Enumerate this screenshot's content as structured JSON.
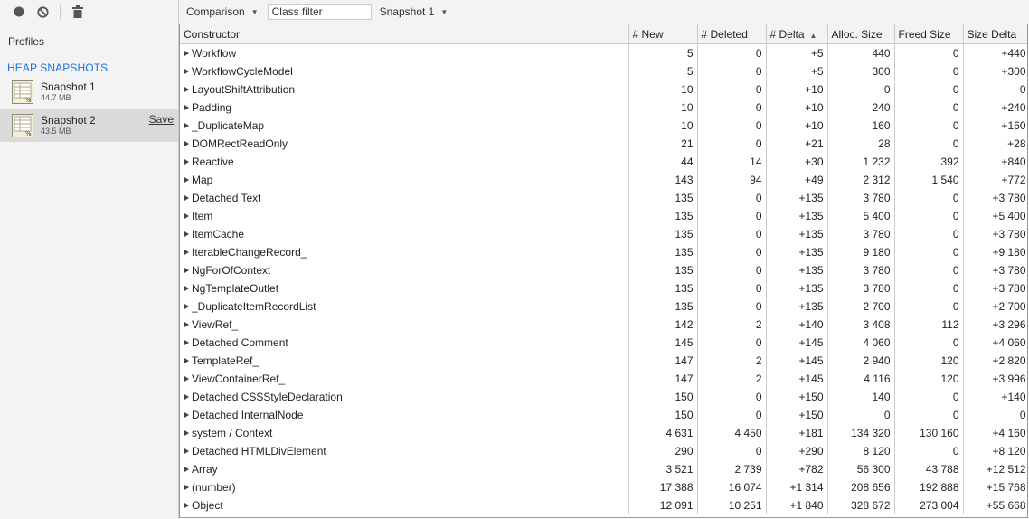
{
  "sidebar": {
    "profiles_label": "Profiles",
    "section_header": "HEAP SNAPSHOTS",
    "snapshots": [
      {
        "title": "Snapshot 1",
        "size": "44.7 MB"
      },
      {
        "title": "Snapshot 2",
        "size": "43.5 MB",
        "action": "Save"
      }
    ]
  },
  "toolbar": {
    "view_mode": "Comparison",
    "class_filter_placeholder": "Class filter",
    "base_snapshot": "Snapshot 1"
  },
  "table": {
    "headers": [
      "Constructor",
      "# New",
      "# Deleted",
      "# Delta",
      "Alloc. Size",
      "Freed Size",
      "Size Delta"
    ],
    "rows": [
      [
        "Workflow",
        "5",
        "0",
        "+5",
        "440",
        "0",
        "+440"
      ],
      [
        "WorkflowCycleModel",
        "5",
        "0",
        "+5",
        "300",
        "0",
        "+300"
      ],
      [
        "LayoutShiftAttribution",
        "10",
        "0",
        "+10",
        "0",
        "0",
        "0"
      ],
      [
        "Padding",
        "10",
        "0",
        "+10",
        "240",
        "0",
        "+240"
      ],
      [
        "_DuplicateMap",
        "10",
        "0",
        "+10",
        "160",
        "0",
        "+160"
      ],
      [
        "DOMRectReadOnly",
        "21",
        "0",
        "+21",
        "28",
        "0",
        "+28"
      ],
      [
        "Reactive",
        "44",
        "14",
        "+30",
        "1 232",
        "392",
        "+840"
      ],
      [
        "Map",
        "143",
        "94",
        "+49",
        "2 312",
        "1 540",
        "+772"
      ],
      [
        "Detached Text",
        "135",
        "0",
        "+135",
        "3 780",
        "0",
        "+3 780"
      ],
      [
        "Item",
        "135",
        "0",
        "+135",
        "5 400",
        "0",
        "+5 400"
      ],
      [
        "ItemCache",
        "135",
        "0",
        "+135",
        "3 780",
        "0",
        "+3 780"
      ],
      [
        "IterableChangeRecord_",
        "135",
        "0",
        "+135",
        "9 180",
        "0",
        "+9 180"
      ],
      [
        "NgForOfContext",
        "135",
        "0",
        "+135",
        "3 780",
        "0",
        "+3 780"
      ],
      [
        "NgTemplateOutlet",
        "135",
        "0",
        "+135",
        "3 780",
        "0",
        "+3 780"
      ],
      [
        "_DuplicateItemRecordList",
        "135",
        "0",
        "+135",
        "2 700",
        "0",
        "+2 700"
      ],
      [
        "ViewRef_",
        "142",
        "2",
        "+140",
        "3 408",
        "112",
        "+3 296"
      ],
      [
        "Detached Comment",
        "145",
        "0",
        "+145",
        "4 060",
        "0",
        "+4 060"
      ],
      [
        "TemplateRef_",
        "147",
        "2",
        "+145",
        "2 940",
        "120",
        "+2 820"
      ],
      [
        "ViewContainerRef_",
        "147",
        "2",
        "+145",
        "4 116",
        "120",
        "+3 996"
      ],
      [
        "Detached CSSStyleDeclaration",
        "150",
        "0",
        "+150",
        "140",
        "0",
        "+140"
      ],
      [
        "Detached InternalNode",
        "150",
        "0",
        "+150",
        "0",
        "0",
        "0"
      ],
      [
        "system / Context",
        "4 631",
        "4 450",
        "+181",
        "134 320",
        "130 160",
        "+4 160"
      ],
      [
        "Detached HTMLDivElement",
        "290",
        "0",
        "+290",
        "8 120",
        "0",
        "+8 120"
      ],
      [
        "Array",
        "3 521",
        "2 739",
        "+782",
        "56 300",
        "43 788",
        "+12 512"
      ],
      [
        "(number)",
        "17 388",
        "16 074",
        "+1 314",
        "208 656",
        "192 888",
        "+15 768"
      ],
      [
        "Object",
        "12 091",
        "10 251",
        "+1 840",
        "328 672",
        "273 004",
        "+55 668"
      ]
    ]
  }
}
